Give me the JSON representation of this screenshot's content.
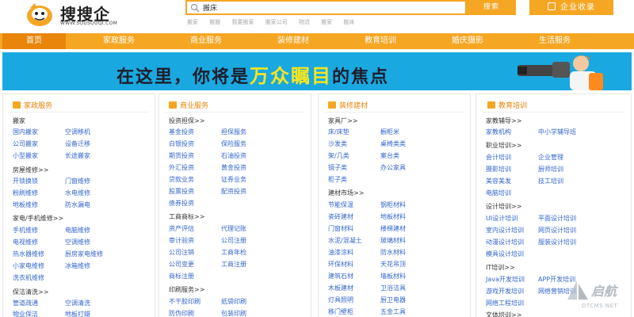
{
  "header": {
    "logo_text": "搜搜企",
    "logo_url": "WWW.SOUSOUQI.COM",
    "search_value": "搬床",
    "search_button": "搜索",
    "hot_words": [
      "搬家",
      "搬搬",
      "我要搬家",
      "搬家公司",
      "物流",
      "搬家",
      "搬床"
    ],
    "enterprise_button": "企业收录"
  },
  "nav": {
    "items": [
      "首页",
      "家政服务",
      "商业服务",
      "装修建材",
      "教育培训",
      "婚庆摄影",
      "生活服务"
    ]
  },
  "banner": {
    "part1": "在这里，你将是",
    "highlight": "万众瞩目",
    "part2": "的焦点"
  },
  "columns": [
    {
      "title": "家政服务",
      "groups": [
        {
          "name": "搬家",
          "links": [
            "国内搬家",
            "空调移机",
            "公司搬家",
            "设备迁移",
            "小型搬家",
            "长途搬家"
          ]
        },
        {
          "name": "房屋维修>>",
          "links": [
            "开锁换锁",
            "门窗维修",
            "粉刷维修",
            "水电维修",
            "地板维修",
            "防水漏电"
          ]
        },
        {
          "name": "家电/手机维修>>",
          "links": [
            "手机维修",
            "电脑维修",
            "电视维修",
            "空调维修",
            "热水器维修",
            "厨房家电维修",
            "小家电维修",
            "冰箱维修",
            "洗衣机维修"
          ]
        },
        {
          "name": "保洁清洗>>",
          "links": [
            "管道疏通",
            "空调清洗",
            "物业保洁",
            "地板打蜡"
          ]
        }
      ]
    },
    {
      "title": "商业服务",
      "groups": [
        {
          "name": "投资担保>>",
          "links": [
            "基金投资",
            "担保服务",
            "白银投资",
            "保险服务",
            "期货投资",
            "石油投资",
            "外汇投资",
            "黄金投资",
            "贷款业务",
            "证券业务",
            "股票投资",
            "配资投资",
            "债券投资"
          ]
        },
        {
          "name": "工商商标>>",
          "links": [
            "资产评估",
            "代理记账",
            "审计验资",
            "公司注册",
            "公司注销",
            "工商年检",
            "公司变更",
            "工商注册",
            "商标注册"
          ]
        },
        {
          "name": "印刷服务>>",
          "links": [
            "不干胶印刷",
            "纸袋印刷",
            "防伪印刷",
            "包装印刷"
          ]
        }
      ]
    },
    {
      "title": "装修建材",
      "groups": [
        {
          "name": "家具厂>>",
          "links": [
            "床/床垫",
            "橱柜米",
            "沙发类",
            "桌椅类类",
            "架/几类",
            "案台类",
            "镜子类",
            "办公家具",
            "柜子类"
          ]
        },
        {
          "name": "建材市场>>",
          "links": [
            "节能保温",
            "钢柜材料",
            "瓷砖建材",
            "地板材料",
            "门窗材料",
            "楼梯建材",
            "水泥/混凝土",
            "玻璃材料",
            "油漆涂料",
            "防水材料",
            "环保材料",
            "天花吊顶",
            "建筑石材",
            "墙板材料",
            "木板建材",
            "卫浴洁具",
            "灯具照明",
            "厨卫电器",
            "移门壁柜",
            "五金工具"
          ]
        }
      ]
    },
    {
      "title": "教育培训",
      "groups": [
        {
          "name": "家教辅导>>",
          "links": [
            "家教机构",
            "中小学辅导班"
          ]
        },
        {
          "name": "职业培训>>",
          "links": [
            "会计培训",
            "企业管理",
            "摄影培训",
            "厨师培训",
            "美容美发",
            "技工培训",
            "电脑培训"
          ]
        },
        {
          "name": "设计培训>>",
          "links": [
            "UI设计培训",
            "平面设计培训",
            "室内设计培训",
            "网页设计培训",
            "动漫设计培训",
            "服装设计培训",
            "模具设计培训"
          ]
        },
        {
          "name": "IT培训>>",
          "links": [
            "Java开发培训",
            "APP开发培训",
            "游戏开发培训",
            "网络营销培训",
            "网络工程培训"
          ]
        },
        {
          "name": "文体培训>>",
          "links": []
        }
      ]
    }
  ],
  "watermark": {
    "text": "启航",
    "url": "DTCMS.NET"
  },
  "colors": {
    "accent": "#f5a623",
    "accent_dark": "#e8850a",
    "banner_bg": "#1aa8e0",
    "link": "#3366cc"
  }
}
